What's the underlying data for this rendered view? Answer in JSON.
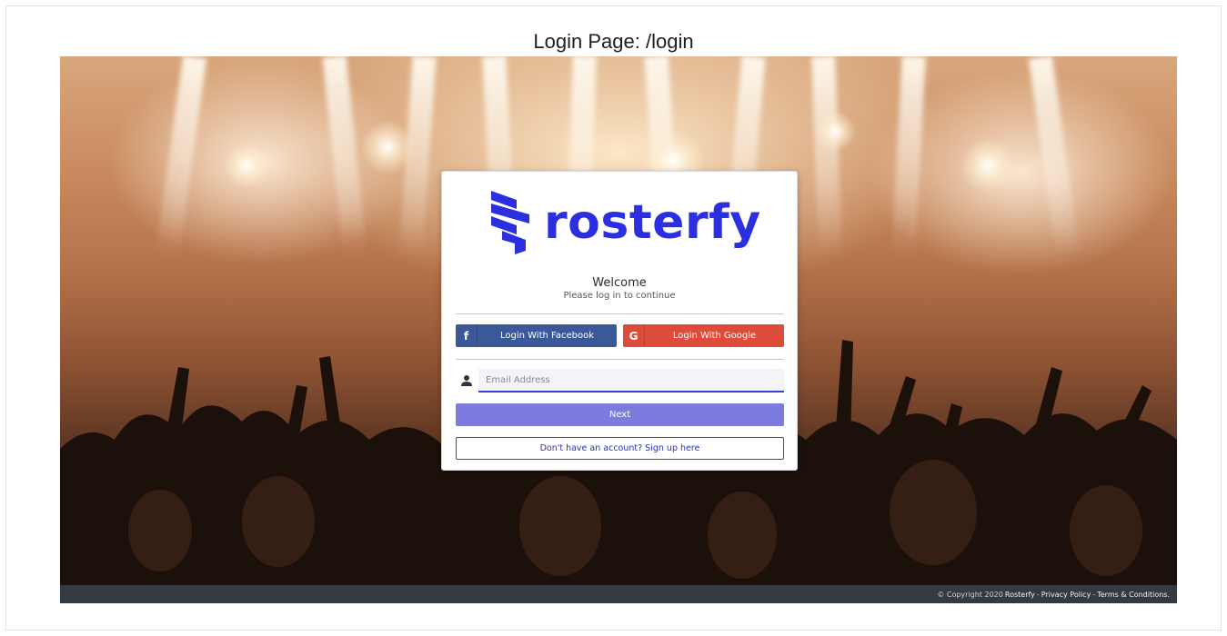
{
  "page_caption": "Login Page: /login",
  "brand": {
    "name": "rosterfy",
    "color": "#2b2fe0"
  },
  "card": {
    "welcome": "Welcome",
    "subtitle": "Please log in to continue",
    "facebook": {
      "icon": "facebook-icon",
      "glyph": "f",
      "label": "Login With Facebook",
      "color": "#3b5998"
    },
    "google": {
      "icon": "google-icon",
      "glyph": "G",
      "label": "Login With Google",
      "color": "#dd4b39"
    },
    "email": {
      "icon": "user-icon",
      "placeholder": "Email Address",
      "value": ""
    },
    "next_label": "Next",
    "signup_label": "Don't have an account? Sign up here"
  },
  "footer": {
    "copyright": "© Copyright 2020",
    "company": "Rosterfy",
    "sep1": "-",
    "privacy": "Privacy Policy",
    "sep2": "-",
    "terms": "Terms & Conditions."
  }
}
